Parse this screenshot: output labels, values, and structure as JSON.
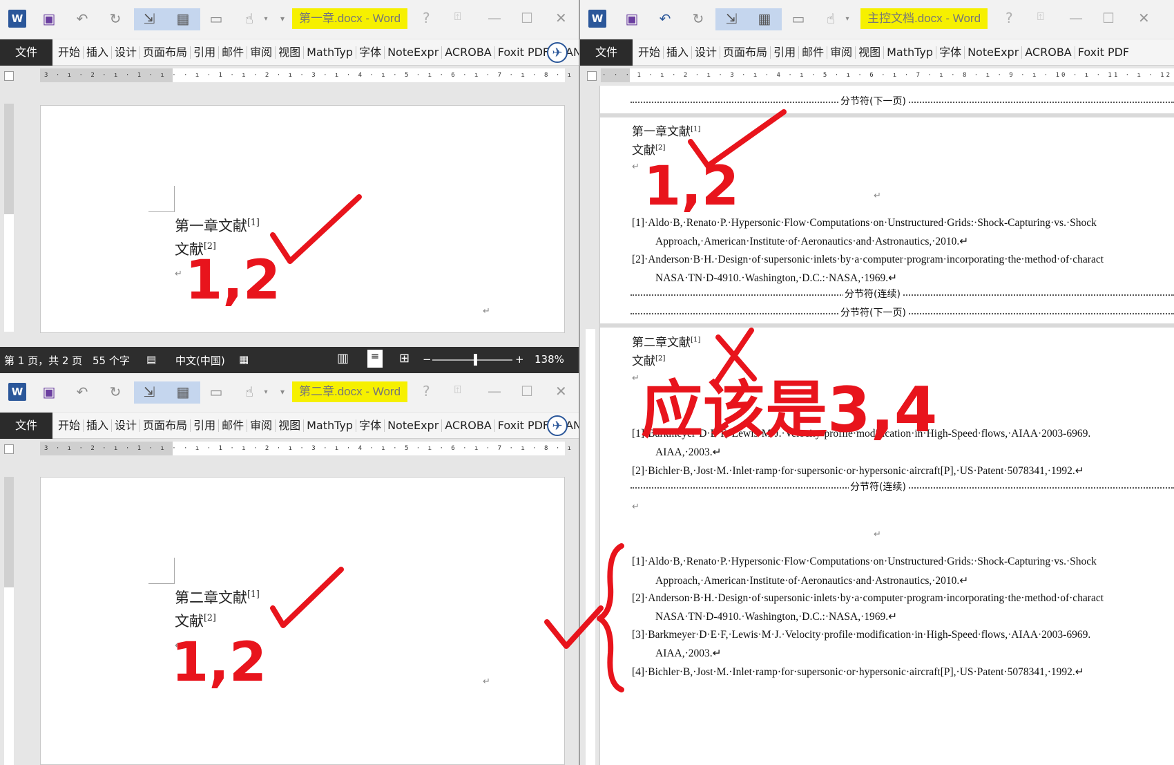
{
  "windows": {
    "ch1": {
      "title": "第一章.docx - Word"
    },
    "master": {
      "title": "主控文档.docx - Word"
    },
    "ch2": {
      "title": "第二章.docx - Word"
    }
  },
  "toolbar": {
    "help": "?",
    "minimize": "—",
    "maximize": "☐",
    "close": "✕"
  },
  "menu": {
    "file": "文件",
    "items": [
      "开始",
      "插入",
      "设计",
      "页面布局",
      "引用",
      "邮件",
      "审阅",
      "视图",
      "MathTyp",
      "字体",
      "NoteExpr",
      "ACROBA",
      "Foxit PDF",
      "WAN..."
    ]
  },
  "ruler": {
    "left": "3 · ı · 2 · ı · 1 · ı ·  · ı · 1 · ı · 2 · ı · 3 · ı · 4 · ı · 5 · ı · 6 · ı · 7 · ı · 8 · ı · 9",
    "master": "· · · 1 · ı · 2 · ı · 3 · ı · 4 · ı · 5 · ı · 6 · ı · 7 · ı · 8 · ı · 9 · ı · 10 · ı · 11 · ı · 12 · ı · 13"
  },
  "ch1_doc": {
    "line1": "第一章文献",
    "line1_sup": "[1]",
    "line2": "文献",
    "line2_sup": "[2]"
  },
  "ch2_doc": {
    "line1": "第二章文献",
    "line1_sup": "[1]",
    "line2": "文献",
    "line2_sup": "[2]"
  },
  "statusbar": {
    "page": "第 1 页，共 2 页",
    "words": "55 个字",
    "language": "中文(中国)",
    "zoom": "138%",
    "zoom_minus": "−",
    "zoom_plus": "+"
  },
  "master_doc": {
    "section_next": "分节符(下一页)",
    "section_cont": "分节符(连续)",
    "ch1_line1": "第一章文献",
    "ch1_line1_sup": "[1]",
    "ch1_line2": "文献",
    "ch1_line2_sup": "[2]",
    "ch1_refs": [
      "[1]·Aldo·B,·Renato·P.·Hypersonic·Flow·Computations·on·Unstructured·Grids:·Shock-Capturing·vs.·Shock",
      "Approach,·American·Institute·of·Aeronautics·and·Astronautics,·2010.↵",
      "[2]·Anderson·B·H.·Design·of·supersonic·inlets·by·a·computer·program·incorporating·the·method·of·charact",
      "NASA·TN·D-4910.·Washington,·D.C.:·NASA,·1969.↵"
    ],
    "ch2_line1": "第二章文献",
    "ch2_line1_sup": "[1]",
    "ch2_line2": "文献",
    "ch2_line2_sup": "[2]",
    "ch2_refs": [
      "[1]·Barkmeyer·D·E·F,·Lewis·M·J.·Velocity·profile·modification·in·High-Speed·flows,·AIAA·2003-6969.",
      "AIAA,·2003.↵",
      "[2]·Bichler·B,·Jost·M.·Inlet·ramp·for·supersonic·or·hypersonic·aircraft[P],·US·Patent·5078341,·1992.↵"
    ],
    "all_refs": [
      "[1]·Aldo·B,·Renato·P.·Hypersonic·Flow·Computations·on·Unstructured·Grids:·Shock-Capturing·vs.·Shock",
      "Approach,·American·Institute·of·Aeronautics·and·Astronautics,·2010.↵",
      "[2]·Anderson·B·H.·Design·of·supersonic·inlets·by·a·computer·program·incorporating·the·method·of·charact",
      "NASA·TN·D-4910.·Washington,·D.C.:·NASA,·1969.↵",
      "[3]·Barkmeyer·D·E·F,·Lewis·M·J.·Velocity·profile·modification·in·High-Speed·flows,·AIAA·2003-6969.",
      "AIAA,·2003.↵",
      "[4]·Bichler·B,·Jost·M.·Inlet·ramp·for·supersonic·or·hypersonic·aircraft[P],·US·Patent·5078341,·1992.↵"
    ]
  },
  "annotations": {
    "ch1_nums": "1,2",
    "ch2_nums": "1,2",
    "master_ch1_nums": "1,2",
    "should_be": "应该是3,4"
  },
  "colors": {
    "highlight": "#f6f000",
    "ink": "#e8141c",
    "word_blue": "#2b579a",
    "selected": "#c5d6ee"
  }
}
